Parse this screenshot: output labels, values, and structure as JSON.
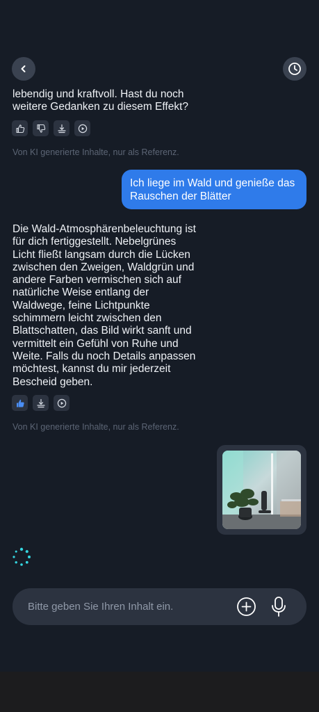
{
  "header": {
    "back_icon": "chevron-left-icon",
    "history_icon": "clock-icon"
  },
  "messages": {
    "ai_1_text": "lebendig und kraftvoll. Hast du noch weitere Gedanken zu diesem Effekt?",
    "ai_1_disclaimer": "Von KI generierte Inhalte, nur als Referenz.",
    "user_1_text": "Ich liege im Wald und genieße das Rauschen der Blätter",
    "ai_2_text": "Die Wald-Atmosphärenbeleuchtung ist für dich fertiggestellt. Nebelgrünes Licht fließt langsam durch die Lücken zwischen den Zweigen, Waldgrün und andere Farben vermischen sich auf natürliche Weise entlang der Waldwege, feine Lichtpunkte schimmern leicht zwischen den Blattschatten, das Bild wirkt sanft und vermittelt ein Gefühl von Ruhe und Weite. Falls du noch Details anpassen möchtest, kannst du mir jederzeit Bescheid geben.",
    "ai_2_disclaimer": "Von KI generierte Inhalte, nur als Referenz."
  },
  "input": {
    "placeholder": "Bitte geben Sie Ihren Inhalt ein."
  },
  "colors": {
    "background": "#161c26",
    "user_bubble": "#2f7bea",
    "liked_accent": "#4a8ef5",
    "loader": "#35d6e0"
  }
}
